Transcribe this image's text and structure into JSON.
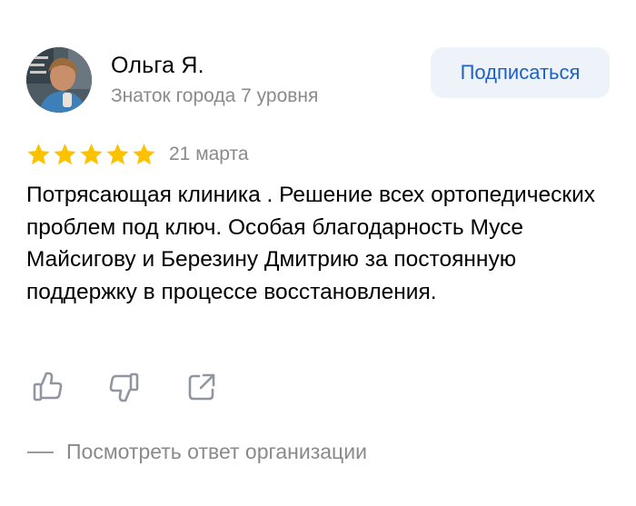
{
  "author": {
    "name": "Ольга Я.",
    "level": "Знаток города 7 уровня",
    "avatar_icon": "user-photo"
  },
  "subscribe": {
    "label": "Подписаться"
  },
  "review": {
    "rating": 5,
    "rating_max": 5,
    "star_color": "#fcc200",
    "date": "21 марта",
    "text": "Потрясающая клиника . Решение всех ортопедических проблем под ключ. Особая благодарность Мусе Майсигову и Березину Дмитрию за постоянную поддержку в процессе восстановления."
  },
  "actions": {
    "like_icon": "thumbs-up-icon",
    "dislike_icon": "thumbs-down-icon",
    "share_icon": "share-icon"
  },
  "org_response": {
    "label": "Посмотреть ответ организации"
  },
  "colors": {
    "accent": "#1e5fc8",
    "button_bg": "#eef2f9",
    "muted_text": "#8a8a8a"
  }
}
